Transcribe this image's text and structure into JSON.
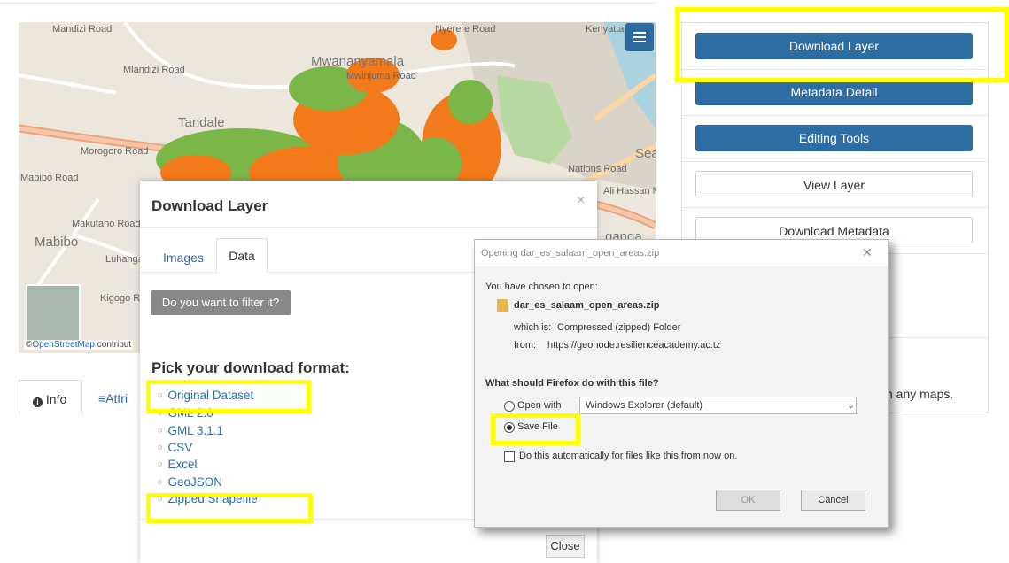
{
  "map": {
    "labels": [
      "Mandizi Road",
      "Mlandizi Road",
      "Mwananyamala",
      "Mwinjuma Road",
      "Tandale",
      "Morogoro Road",
      "Makutano Road",
      "Mabibo",
      "Luhanga Street",
      "Kigogo Road",
      "Kenyatta",
      "Nyerere Road",
      "Nations Road",
      "Sea V",
      "Ali Hassan Mwinyi",
      "Mabibo Road",
      "ganga"
    ],
    "attribution_prefix": "©",
    "attribution_link": "OpenStreetMap",
    "attribution_suffix": " contribut",
    "layer_colors": [
      "#7ab648",
      "#f27a1a"
    ]
  },
  "right_panel": {
    "download_layer": "Download Layer",
    "metadata_detail": "Metadata Detail",
    "editing_tools": "Editing Tools",
    "view_layer": "View Layer",
    "download_metadata": "Download Metadata",
    "bottom_text": "n any maps."
  },
  "tabs": {
    "info": "Info",
    "info_icon": "info-circle-icon",
    "attributes": "Attri",
    "attributes_icon": "list-icon"
  },
  "modal": {
    "title": "Download Layer",
    "close_symbol": "×",
    "tab_images": "Images",
    "tab_data": "Data",
    "filter_button": "Do you want to filter it?",
    "pick_heading": "Pick your download format:",
    "formats": [
      "Original Dataset",
      "GML 2.0",
      "GML 3.1.1",
      "CSV",
      "Excel",
      "GeoJSON",
      "Zipped Shapefile"
    ],
    "close_button": "Close"
  },
  "firefox_dialog": {
    "title": "Opening dar_es_salaam_open_areas.zip",
    "close_symbol": "✕",
    "chosen_text": "You have chosen to open:",
    "filename": "dar_es_salaam_open_areas.zip",
    "which_is_label": "which is:",
    "which_is_value": "Compressed (zipped) Folder",
    "from_label": "from:",
    "from_value": "https://geonode.resilienceacademy.ac.tz",
    "question": "What should Firefox do with this file?",
    "open_with_label": "Open with",
    "open_with_value": "Windows Explorer (default)",
    "save_file_label": "Save File",
    "auto_label": "Do this automatically for files like this from now on.",
    "ok": "OK",
    "cancel": "Cancel"
  },
  "highlight_color": "#ffff00"
}
